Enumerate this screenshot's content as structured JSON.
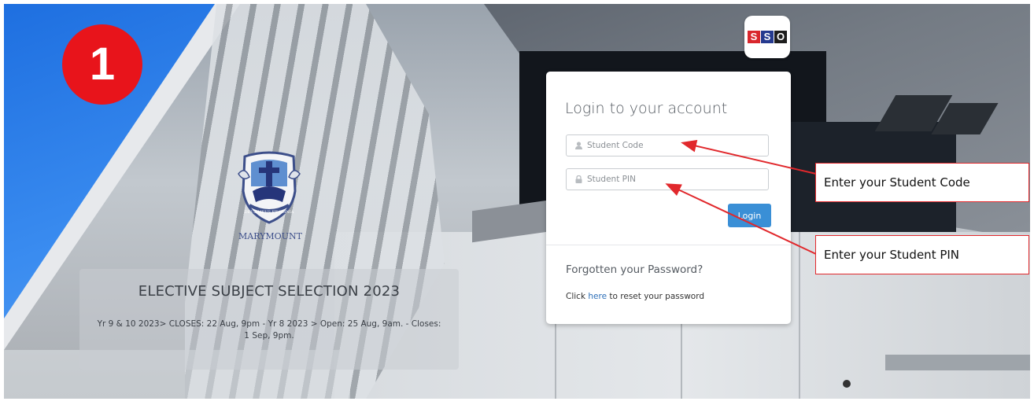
{
  "step": {
    "number": "1",
    "color": "#e8141b"
  },
  "school": {
    "name": "MARYMOUNT",
    "crest_motto": "DEUS MEUS ET OMNIA"
  },
  "banner": {
    "title": "ELECTIVE SUBJECT SELECTION 2023",
    "text": "Yr 9 & 10 2023> CLOSES: 22 Aug, 9pm - Yr 8 2023 > Open: 25 Aug, 9am. - Closes: 1 Sep, 9pm."
  },
  "sso_logo": {
    "letters": [
      "S",
      "S",
      "O"
    ],
    "colors": [
      "#d9262c",
      "#253a8f",
      "#1d1d1d"
    ]
  },
  "login": {
    "title": "Login to your account",
    "student_code_placeholder": "Student Code",
    "student_pin_placeholder": "Student PIN",
    "login_label": "Login",
    "button_color": "#3a8fd6",
    "user_icon": "user-icon",
    "lock_icon": "lock-icon"
  },
  "forgot": {
    "title": "Forgotten your Password?",
    "prefix": "Click",
    "link": "here",
    "suffix": "to reset your password"
  },
  "callouts": {
    "student_code": "Enter your Student Code",
    "student_pin": "Enter your Student PIN",
    "color": "#e1282c"
  }
}
